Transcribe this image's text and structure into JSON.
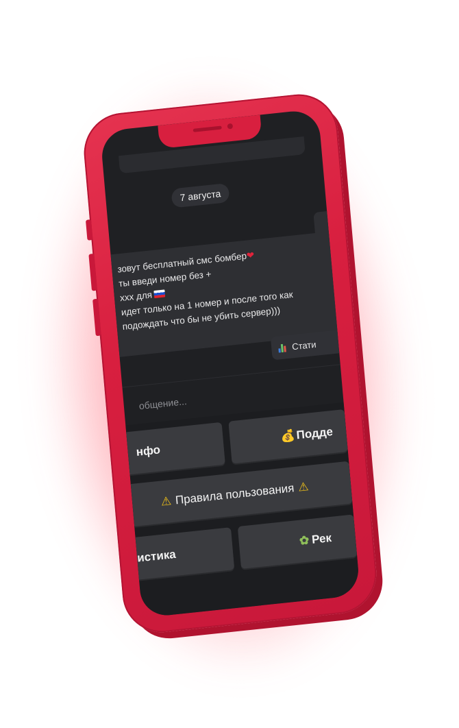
{
  "chat": {
    "date": "7 августа",
    "message_lines": [
      "зовут бесплатный смс бомбер",
      "ты введи номер без +",
      "xxx для",
      "идет только на 1 номер и после того как",
      "подождать что бы не убить сервер)))"
    ],
    "stat_button": "Стати",
    "input_placeholder": "общение..."
  },
  "keyboard": {
    "row1_left": "нфо",
    "row1_right": "Подде",
    "row2": "Правила пользования",
    "row3_left": "истика",
    "row3_right": "Рек"
  },
  "icons": {
    "heart": "heart-icon",
    "flag": "russia-flag-icon",
    "stats": "bar-chart-icon",
    "money": "money-bag-icon",
    "warning": "warning-icon",
    "ad": "leaf-icon"
  },
  "colors": {
    "phone_case": "#d81f3f",
    "screen_bg": "#1f2023",
    "button_bg": "#3a3b3f"
  }
}
